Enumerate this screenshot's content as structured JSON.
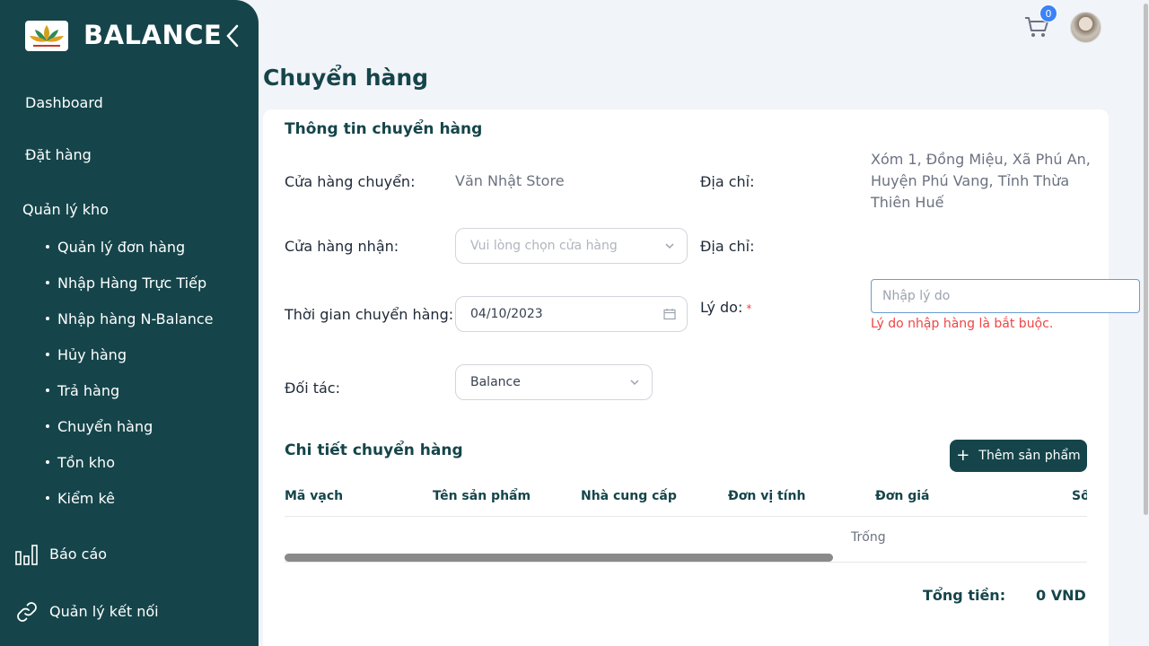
{
  "sidebar": {
    "brand": "BALANCE",
    "items": {
      "dashboard": "Dashboard",
      "order": "Đặt hàng",
      "warehouse": "Quản lý kho",
      "report": "Báo cáo",
      "connection": "Quản lý kết nối"
    },
    "sub_items": [
      "Quản lý đơn hàng",
      "Nhập Hàng Trực Tiếp",
      "Nhập hàng N-Balance",
      "Hủy hàng",
      "Trả hàng",
      "Chuyển hàng",
      "Tồn kho",
      "Kiểm kê"
    ]
  },
  "header": {
    "cart_count": "0"
  },
  "page": {
    "title": "Chuyển hàng"
  },
  "info": {
    "title": "Thông tin chuyển hàng",
    "from_store_label": "Cửa hàng chuyển:",
    "from_store_value": "Văn Nhật Store",
    "address_label": "Địa chỉ:",
    "from_address_value": "Xóm 1, Đồng Miệu, Xã Phú An, Huyện Phú Vang, Tỉnh Thừa Thiên Huế",
    "to_store_label": "Cửa hàng nhận:",
    "to_store_placeholder": "Vui lòng chọn cửa hàng",
    "to_address_label": "Địa chỉ:",
    "date_label": "Thời gian chuyển hàng:",
    "date_value": "04/10/2023",
    "reason_label": "Lý do:",
    "reason_required": "*",
    "reason_placeholder": "Nhập lý do",
    "reason_error": "Lý do nhập hàng là bắt buộc.",
    "partner_label": "Đối tác:",
    "partner_value": "Balance"
  },
  "detail": {
    "title": "Chi tiết chuyển hàng",
    "add_button": "Thêm sản phẩm",
    "columns": [
      "Mã vạch",
      "Tên sản phẩm",
      "Nhà cung cấp",
      "Đơn vị tính",
      "Đơn giá",
      "Số"
    ],
    "empty_text": "Trống",
    "total_label": "Tổng tiền:",
    "total_value": "0 VND"
  }
}
